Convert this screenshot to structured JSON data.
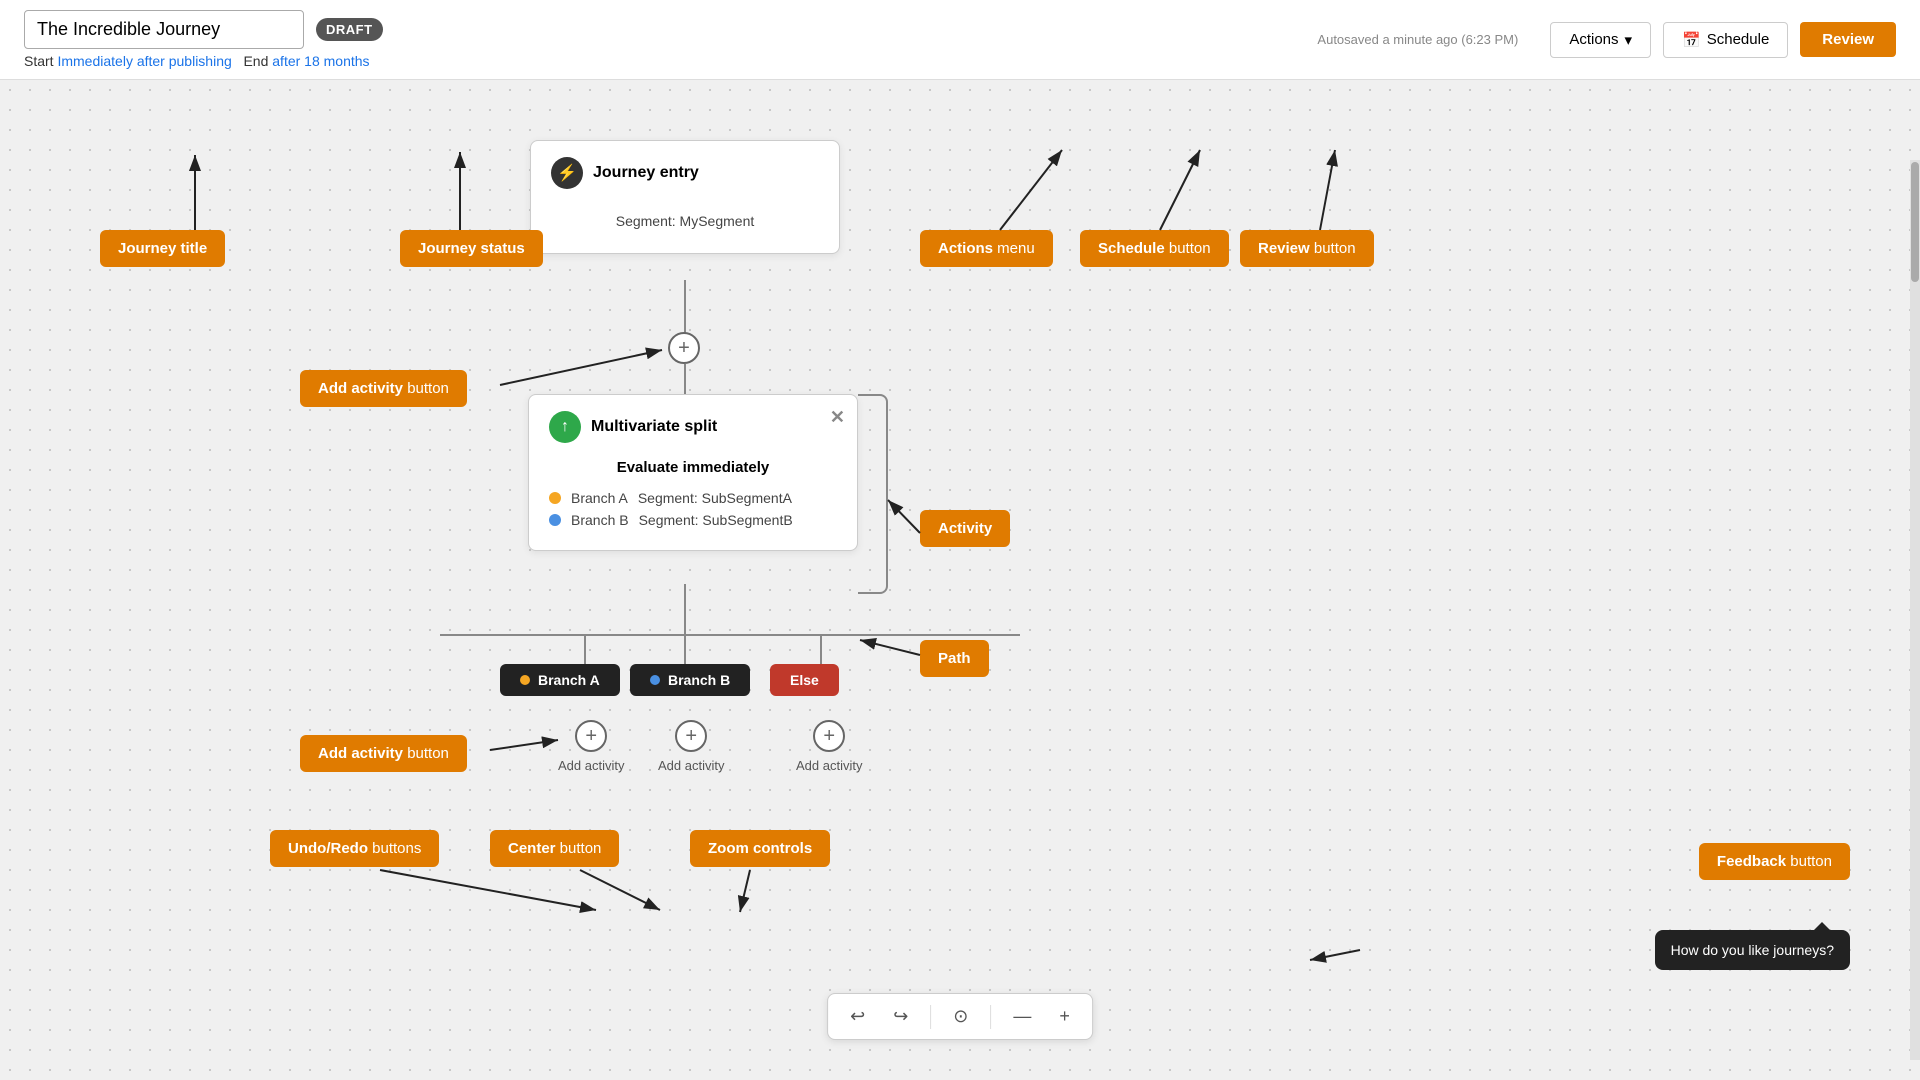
{
  "topbar": {
    "title": "The Incredible Journey",
    "draft_label": "DRAFT",
    "autosave_text": "Autosaved a minute ago (6:23 PM)",
    "start_label": "Start",
    "start_link": "Immediately after publishing",
    "end_label": "End",
    "end_link": "after 18 months",
    "actions_label": "Actions",
    "schedule_label": "Schedule",
    "review_label": "Review"
  },
  "canvas": {
    "journey_entry_card": {
      "icon": "⚡",
      "title": "Journey entry",
      "content": "Segment: MySegment"
    },
    "multivariate_card": {
      "icon": "↑",
      "title": "Multivariate split",
      "evaluate_label": "Evaluate immediately",
      "branch_a_label": "Branch A",
      "branch_a_segment": "Segment: SubSegmentA",
      "branch_b_label": "Branch B",
      "branch_b_segment": "Segment: SubSegmentB"
    },
    "branches": [
      {
        "label": "Branch A",
        "color": "#222",
        "dot_color": "#f5a623"
      },
      {
        "label": "Branch B",
        "color": "#222",
        "dot_color": "#4a90e2"
      },
      {
        "label": "Else",
        "color": "#c0392b",
        "dot_color": null
      }
    ],
    "add_activity_label": "Add activity",
    "plus_symbol": "+",
    "feedback_text": "How do you like journeys?"
  },
  "annotations": {
    "journey_title": "Journey title",
    "journey_status": "Journey status",
    "actions_menu": "Actions menu",
    "schedule_button": "Schedule button",
    "review_button": "Review button",
    "add_activity_button_top": "Add activity button",
    "activity_label": "Activity",
    "path_label": "Path",
    "add_activity_button_bottom": "Add activity button",
    "undo_redo_label": "Undo/Redo buttons",
    "center_label": "Center button",
    "zoom_label": "Zoom controls",
    "feedback_label": "Feedback button"
  },
  "toolbar": {
    "undo_icon": "↩",
    "redo_icon": "↪",
    "center_icon": "⊙",
    "zoom_out_icon": "—",
    "zoom_in_icon": "+"
  }
}
